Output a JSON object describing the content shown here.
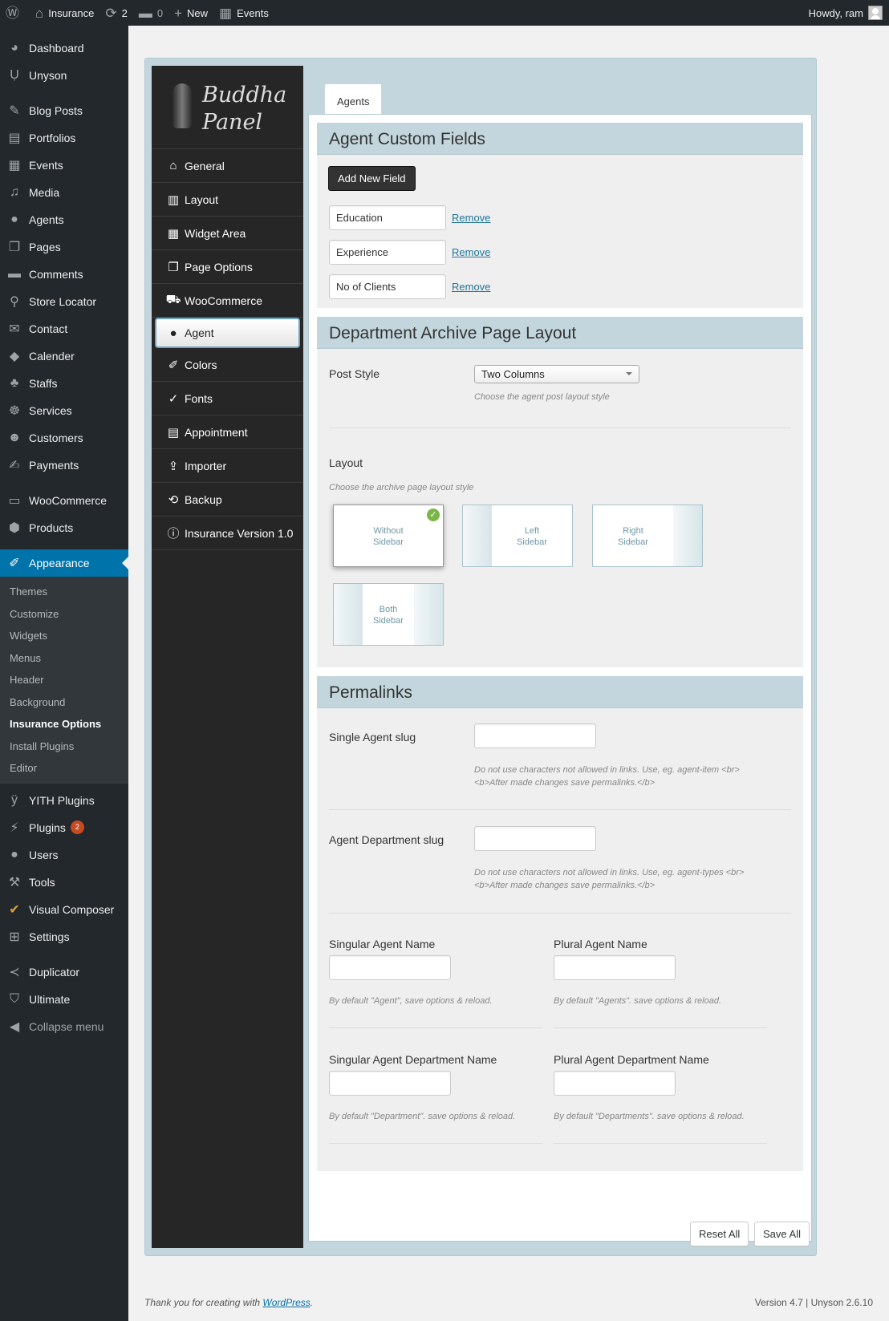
{
  "admin_bar": {
    "site_name": "Insurance",
    "updates_count": "2",
    "comments_count": "0",
    "new_label": "New",
    "events_label": "Events",
    "howdy": "Howdy, ram"
  },
  "menu": {
    "items": [
      {
        "label": "Dashboard",
        "icon": "dashboard-icon"
      },
      {
        "label": "Unyson",
        "icon": "unyson-icon"
      },
      {
        "label": "Blog Posts",
        "icon": "pin-icon"
      },
      {
        "label": "Portfolios",
        "icon": "portfolio-icon"
      },
      {
        "label": "Events",
        "icon": "calendar-icon"
      },
      {
        "label": "Media",
        "icon": "media-icon"
      },
      {
        "label": "Agents",
        "icon": "user-icon"
      },
      {
        "label": "Pages",
        "icon": "pages-icon"
      },
      {
        "label": "Comments",
        "icon": "comment-icon"
      },
      {
        "label": "Store Locator",
        "icon": "location-icon"
      },
      {
        "label": "Contact",
        "icon": "mail-icon"
      },
      {
        "label": "Calender",
        "icon": "tag-icon"
      },
      {
        "label": "Staffs",
        "icon": "group-icon"
      },
      {
        "label": "Services",
        "icon": "services-icon"
      },
      {
        "label": "Customers",
        "icon": "customers-icon"
      },
      {
        "label": "Payments",
        "icon": "edit-icon"
      },
      {
        "label": "WooCommerce",
        "icon": "woo-icon"
      },
      {
        "label": "Products",
        "icon": "products-icon"
      },
      {
        "label": "Appearance",
        "icon": "appearance-icon"
      },
      {
        "label": "YITH Plugins",
        "icon": "yith-icon"
      },
      {
        "label": "Plugins",
        "icon": "plugins-icon",
        "badge": "2"
      },
      {
        "label": "Users",
        "icon": "users-icon"
      },
      {
        "label": "Tools",
        "icon": "wrench-icon"
      },
      {
        "label": "Visual Composer",
        "icon": "vc-icon"
      },
      {
        "label": "Settings",
        "icon": "settings-icon"
      },
      {
        "label": "Duplicator",
        "icon": "share-icon"
      },
      {
        "label": "Ultimate",
        "icon": "shield-icon"
      },
      {
        "label": "Collapse menu",
        "icon": "collapse-icon"
      }
    ],
    "submenu": [
      "Themes",
      "Customize",
      "Widgets",
      "Menus",
      "Header",
      "Background",
      "Insurance Options",
      "Install Plugins",
      "Editor"
    ]
  },
  "panel": {
    "logo_line1": "Buddha",
    "logo_line2": "Panel",
    "nav": [
      "General",
      "Layout",
      "Widget Area",
      "Page Options",
      "WooCommerce",
      "Agent",
      "Colors",
      "Fonts",
      "Appointment",
      "Importer",
      "Backup",
      "Insurance Version 1.0"
    ],
    "tab": "Agents"
  },
  "custom_fields": {
    "title": "Agent Custom Fields",
    "add_button": "Add New Field",
    "remove_label": "Remove",
    "fields": [
      "Education",
      "Experience",
      "No of Clients"
    ]
  },
  "archive": {
    "title": "Department Archive Page Layout",
    "post_style_label": "Post Style",
    "post_style_value": "Two Columns",
    "post_style_hint": "Choose the agent post layout style",
    "layout_label": "Layout",
    "layout_hint": "Choose the archive page layout style",
    "layouts": [
      {
        "line1": "Without",
        "line2": "Sidebar"
      },
      {
        "line1": "Left",
        "line2": "Sidebar"
      },
      {
        "line1": "Right",
        "line2": "Sidebar"
      },
      {
        "line1": "Both",
        "line2": "Sidebar"
      }
    ]
  },
  "permalinks": {
    "title": "Permalinks",
    "single_slug_label": "Single Agent slug",
    "single_slug_hint1": "Do not use characters not allowed in links. Use, eg. agent-item <br>",
    "single_slug_hint2": "<b>After made changes save permalinks.</b>",
    "dept_slug_label": "Agent Department slug",
    "dept_slug_hint1": "Do not use characters not allowed in links. Use, eg. agent-types <br>",
    "dept_slug_hint2": "<b>After made changes save permalinks.</b>",
    "singular_name_label": "Singular Agent Name",
    "singular_name_hint": "By default \"Agent\", save options & reload.",
    "plural_name_label": "Plural Agent Name",
    "plural_name_hint": "By default \"Agents\". save options & reload.",
    "singular_dept_label": "Singular Agent Department Name",
    "singular_dept_hint": "By default \"Department\". save options & reload.",
    "plural_dept_label": "Plural Agent Department Name",
    "plural_dept_hint": "By default \"Departments\". save options & reload."
  },
  "actions": {
    "reset": "Reset All",
    "save": "Save All"
  },
  "footer": {
    "thanks": "Thank you for creating with",
    "wp_link": "WordPress",
    "version": "Version 4.7 | Unyson 2.6.10"
  }
}
